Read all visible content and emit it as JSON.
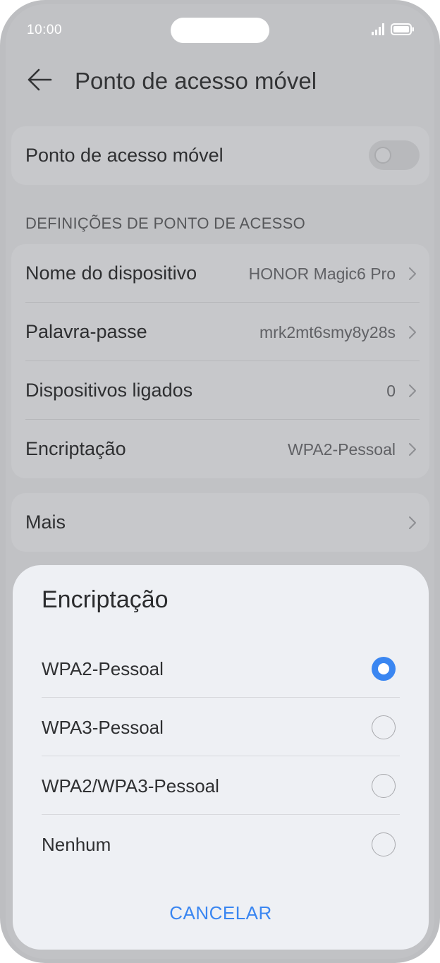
{
  "status_bar": {
    "time": "10:00",
    "icons": [
      "signal-icon",
      "battery-icon"
    ]
  },
  "header": {
    "title": "Ponto de acesso móvel",
    "back_icon": "arrow-left-icon"
  },
  "hotspot": {
    "label": "Ponto de acesso móvel",
    "enabled": false
  },
  "settings": {
    "section_title": "DEFINIÇÕES DE PONTO DE ACESSO",
    "rows": [
      {
        "label": "Nome do dispositivo",
        "value": "HONOR Magic6 Pro"
      },
      {
        "label": "Palavra-passe",
        "value": "mrk2mt6smy8y28s"
      },
      {
        "label": "Dispositivos ligados",
        "value": "0"
      },
      {
        "label": "Encriptação",
        "value": "WPA2-Pessoal"
      }
    ]
  },
  "more": {
    "label": "Mais"
  },
  "dialog": {
    "title": "Encriptação",
    "options": [
      {
        "label": "WPA2-Pessoal",
        "selected": true
      },
      {
        "label": "WPA3-Pessoal",
        "selected": false
      },
      {
        "label": "WPA2/WPA3-Pessoal",
        "selected": false
      },
      {
        "label": "Nenhum",
        "selected": false
      }
    ],
    "cancel_label": "CANCELAR"
  },
  "colors": {
    "accent": "#3a86f1",
    "scrim": "#c1c2c5",
    "sheet": "#eef0f4"
  }
}
